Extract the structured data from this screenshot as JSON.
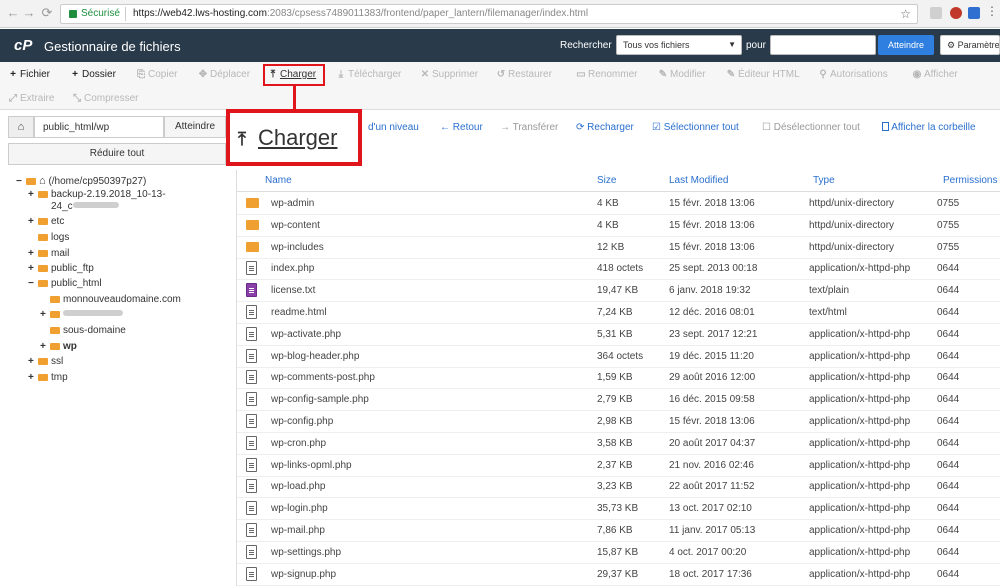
{
  "browser": {
    "secure_label": "Sécurisé",
    "url_host": "https://web42.lws-hosting.com",
    "url_rest": ":2083/cpsess7489011383/frontend/paper_lantern/filemanager/index.html"
  },
  "header": {
    "logo": "cP",
    "title": "Gestionnaire de fichiers",
    "search_label": "Rechercher",
    "search_scope": "Tous vos fichiers",
    "for_label": "pour",
    "go_label": "Atteindre",
    "settings_label": "Paramètres"
  },
  "toolbar": [
    {
      "label": "Fichier",
      "icon": "+",
      "state": "active"
    },
    {
      "label": "Dossier",
      "icon": "+",
      "state": "active"
    },
    {
      "label": "Copier",
      "icon": "⎘",
      "state": "disabled"
    },
    {
      "label": "Déplacer",
      "icon": "✥",
      "state": "disabled"
    },
    {
      "label": "Charger",
      "icon": "⤒",
      "state": "upload"
    },
    {
      "label": "Télécharger",
      "icon": "⤓",
      "state": "disabled"
    },
    {
      "label": "Supprimer",
      "icon": "✕",
      "state": "disabled"
    },
    {
      "label": "Restaurer",
      "icon": "↺",
      "state": "disabled"
    },
    {
      "label": "Renommer",
      "icon": "▭",
      "state": "disabled"
    },
    {
      "label": "Modifier",
      "icon": "✎",
      "state": "disabled"
    },
    {
      "label": "Éditeur HTML",
      "icon": "✎",
      "state": "disabled"
    },
    {
      "label": "Autorisations",
      "icon": "⚲",
      "state": "disabled"
    },
    {
      "label": "Afficher",
      "icon": "◉",
      "state": "disabled"
    },
    {
      "label": "Extraire",
      "icon": "⤢",
      "state": "disabled"
    },
    {
      "label": "Compresser",
      "icon": "⤡",
      "state": "disabled"
    }
  ],
  "callout": {
    "label": "Charger"
  },
  "pathbar": {
    "path": "public_html/wp",
    "go_label": "Atteindre",
    "collapse_label": "Réduire tout"
  },
  "navlinks": [
    {
      "label": "d'un niveau",
      "icon": ""
    },
    {
      "label": "Retour",
      "icon": "←"
    },
    {
      "label": "Transférer",
      "icon": "→"
    },
    {
      "label": "Recharger",
      "icon": "⟳"
    },
    {
      "label": "Sélectionner tout",
      "icon": "☑"
    },
    {
      "label": "Désélectionner tout",
      "icon": "☐"
    },
    {
      "label": "Afficher la corbeille",
      "icon": "🗑"
    }
  ],
  "tree": [
    {
      "label": "(/home/cp950397p27)",
      "toggle": "−",
      "kind": "home"
    },
    {
      "label": "backup-2.19.2018_10-13-",
      "label2": "24_c",
      "toggle": "+",
      "kind": "folder"
    },
    {
      "label": "etc",
      "toggle": "+",
      "kind": "folder"
    },
    {
      "label": "logs",
      "toggle": "",
      "kind": "folder"
    },
    {
      "label": "mail",
      "toggle": "+",
      "kind": "folder"
    },
    {
      "label": "public_ftp",
      "toggle": "+",
      "kind": "folder"
    },
    {
      "label": "public_html",
      "toggle": "−",
      "kind": "folder"
    },
    {
      "label": "monnouveaudomaine.com",
      "toggle": "",
      "kind": "folder"
    },
    {
      "label": "",
      "toggle": "+",
      "kind": "folder"
    },
    {
      "label": "sous-domaine",
      "toggle": "",
      "kind": "folder"
    },
    {
      "label": "wp",
      "toggle": "+",
      "kind": "folder"
    },
    {
      "label": "ssl",
      "toggle": "+",
      "kind": "folder"
    },
    {
      "label": "tmp",
      "toggle": "+",
      "kind": "folder"
    }
  ],
  "table": {
    "headers": [
      "Name",
      "Size",
      "Last Modified",
      "Type",
      "Permissions"
    ],
    "rows": [
      {
        "name": "wp-admin",
        "size": "4 KB",
        "modified": "15 févr. 2018 13:06",
        "type": "httpd/unix-directory",
        "perms": "0755",
        "kind": "dir"
      },
      {
        "name": "wp-content",
        "size": "4 KB",
        "modified": "15 févr. 2018 13:06",
        "type": "httpd/unix-directory",
        "perms": "0755",
        "kind": "dir"
      },
      {
        "name": "wp-includes",
        "size": "12 KB",
        "modified": "15 févr. 2018 13:06",
        "type": "httpd/unix-directory",
        "perms": "0755",
        "kind": "dir"
      },
      {
        "name": "index.php",
        "size": "418 octets",
        "modified": "25 sept. 2013 00:18",
        "type": "application/x-httpd-php",
        "perms": "0644",
        "kind": "file"
      },
      {
        "name": "license.txt",
        "size": "19,47 KB",
        "modified": "6 janv. 2018 19:32",
        "type": "text/plain",
        "perms": "0644",
        "kind": "txt"
      },
      {
        "name": "readme.html",
        "size": "7,24 KB",
        "modified": "12 déc. 2016 08:01",
        "type": "text/html",
        "perms": "0644",
        "kind": "file"
      },
      {
        "name": "wp-activate.php",
        "size": "5,31 KB",
        "modified": "23 sept. 2017 12:21",
        "type": "application/x-httpd-php",
        "perms": "0644",
        "kind": "file"
      },
      {
        "name": "wp-blog-header.php",
        "size": "364 octets",
        "modified": "19 déc. 2015 11:20",
        "type": "application/x-httpd-php",
        "perms": "0644",
        "kind": "file"
      },
      {
        "name": "wp-comments-post.php",
        "size": "1,59 KB",
        "modified": "29 août 2016 12:00",
        "type": "application/x-httpd-php",
        "perms": "0644",
        "kind": "file"
      },
      {
        "name": "wp-config-sample.php",
        "size": "2,79 KB",
        "modified": "16 déc. 2015 09:58",
        "type": "application/x-httpd-php",
        "perms": "0644",
        "kind": "file"
      },
      {
        "name": "wp-config.php",
        "size": "2,98 KB",
        "modified": "15 févr. 2018 13:06",
        "type": "application/x-httpd-php",
        "perms": "0644",
        "kind": "file"
      },
      {
        "name": "wp-cron.php",
        "size": "3,58 KB",
        "modified": "20 août 2017 04:37",
        "type": "application/x-httpd-php",
        "perms": "0644",
        "kind": "file"
      },
      {
        "name": "wp-links-opml.php",
        "size": "2,37 KB",
        "modified": "21 nov. 2016 02:46",
        "type": "application/x-httpd-php",
        "perms": "0644",
        "kind": "file"
      },
      {
        "name": "wp-load.php",
        "size": "3,23 KB",
        "modified": "22 août 2017 11:52",
        "type": "application/x-httpd-php",
        "perms": "0644",
        "kind": "file"
      },
      {
        "name": "wp-login.php",
        "size": "35,73 KB",
        "modified": "13 oct. 2017 02:10",
        "type": "application/x-httpd-php",
        "perms": "0644",
        "kind": "file"
      },
      {
        "name": "wp-mail.php",
        "size": "7,86 KB",
        "modified": "11 janv. 2017 05:13",
        "type": "application/x-httpd-php",
        "perms": "0644",
        "kind": "file"
      },
      {
        "name": "wp-settings.php",
        "size": "15,87 KB",
        "modified": "4 oct. 2017 00:20",
        "type": "application/x-httpd-php",
        "perms": "0644",
        "kind": "file"
      },
      {
        "name": "wp-signup.php",
        "size": "29,37 KB",
        "modified": "18 oct. 2017 17:36",
        "type": "application/x-httpd-php",
        "perms": "0644",
        "kind": "file"
      }
    ]
  },
  "colors": {
    "header_bg": "#293a4a",
    "accent": "#2a6fcf",
    "highlight": "#e0151b",
    "folder": "#f0a030"
  }
}
